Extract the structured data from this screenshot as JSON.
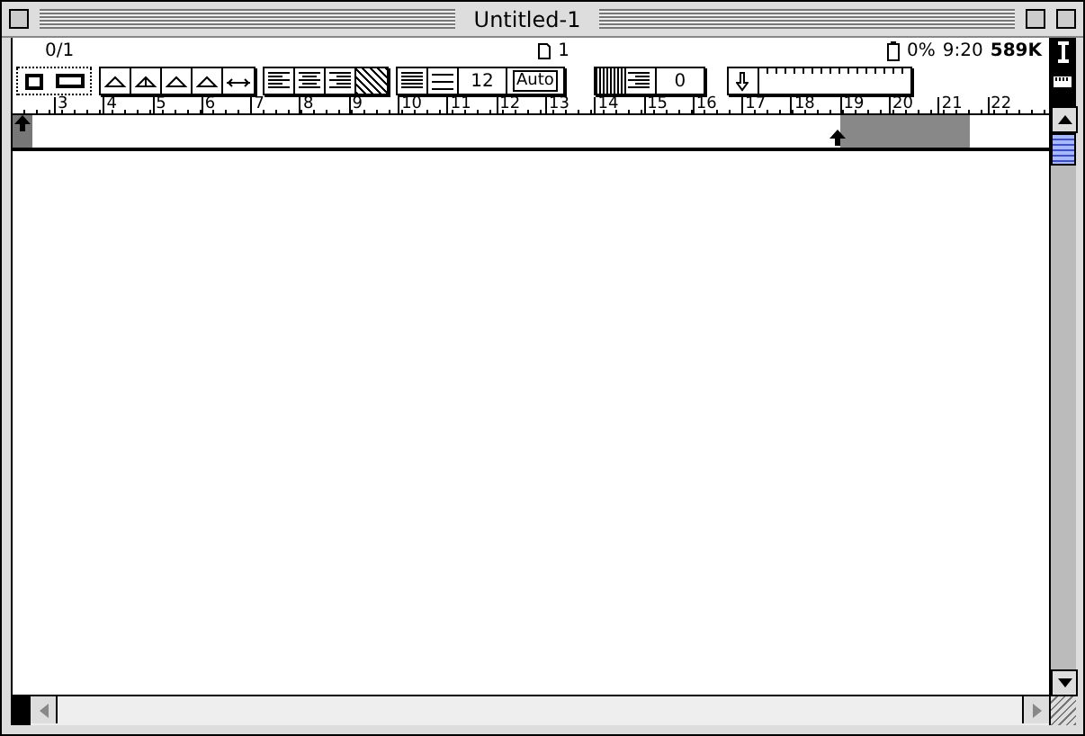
{
  "window": {
    "title": "Untitled-1"
  },
  "status": {
    "selection": "0/1",
    "page": "1",
    "battery": "0%",
    "time": "9:20",
    "memory": "589K"
  },
  "toolbar": {
    "alignment": [
      {
        "selected": false
      },
      {
        "selected": false
      },
      {
        "selected": false
      },
      {
        "selected": true
      }
    ],
    "font_size": "12",
    "line_spacing": "Auto",
    "spacing_value": "0"
  },
  "ruler": {
    "labels": [
      "3",
      "4",
      "5",
      "6",
      "7",
      "8",
      "9",
      "10",
      "11",
      "12",
      "13",
      "14",
      "15",
      "16",
      "17",
      "18",
      "19",
      "20",
      "21",
      "22"
    ]
  }
}
